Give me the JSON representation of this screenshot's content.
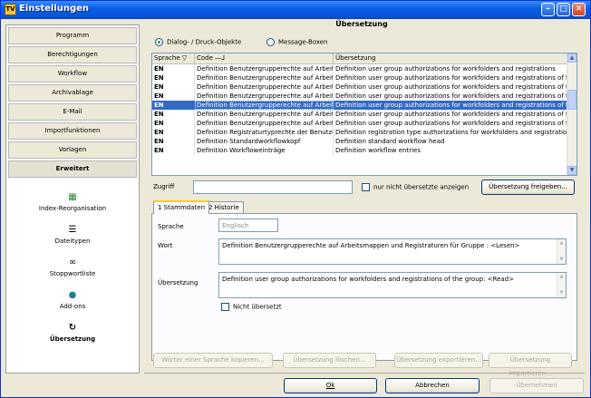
{
  "window": {
    "title": "Einstellungen",
    "app_icon_label": "TV"
  },
  "sidebar": {
    "items": [
      {
        "label": "Programm"
      },
      {
        "label": "Berechtigungen"
      },
      {
        "label": "Workflow"
      },
      {
        "label": "Archivablage"
      },
      {
        "label": "E-Mail"
      },
      {
        "label": "Importfunktionen"
      },
      {
        "label": "Vorlagen"
      },
      {
        "label": "Erweitert"
      }
    ],
    "tools": [
      {
        "label": "Index-Reorganisation",
        "icon": "index-icon"
      },
      {
        "label": "Dateitypen",
        "icon": "list-icon"
      },
      {
        "label": "Stoppwortliste",
        "icon": "chain-icon"
      },
      {
        "label": "Add-ons",
        "icon": "globe-icon"
      },
      {
        "label": "Übersetzung",
        "icon": "translate-icon"
      }
    ]
  },
  "main": {
    "title": "Übersetzung",
    "radio_dialog": "Dialog- / Druck-Objekte",
    "radio_message": "Message-Boxen"
  },
  "grid": {
    "columns": [
      "Sprache",
      "Code",
      "Übersetzung"
    ],
    "rows": [
      {
        "lang": "EN",
        "code": "Definition Benutzergrupperechte auf Arbeitsma",
        "translation": "Definition user group authorizations for workfolders and registrations"
      },
      {
        "lang": "EN",
        "code": "Definition Benutzergrupperechte auf Arbeitsma",
        "translation": "Definition user group authorizations for workfolders and registrations of the group: <"
      },
      {
        "lang": "EN",
        "code": "Definition Benutzergrupperechte auf Arbeitsma",
        "translation": "Definition user group authorizations for workfolders and registrations of the group: <"
      },
      {
        "lang": "EN",
        "code": "Definition Benutzergrupperechte auf Arbeitsma",
        "translation": "Definition user group authorizations for workfolders and registrations of the group: <"
      },
      {
        "lang": "EN",
        "code": "Definition Benutzergrupperechte auf Arbeitsma",
        "translation": "Definition user group authorizations for workfolders and registrations of the group: <"
      },
      {
        "lang": "EN",
        "code": "Definition Benutzergrupperechte auf Arbeitsma",
        "translation": "Definition user group authorizations for workfolders and registrations of the group: <"
      },
      {
        "lang": "EN",
        "code": "Definition Benutzergrupperechte auf Arbeitsma",
        "translation": "Definition user group authorizations for workfolders and registrations of the group: <"
      },
      {
        "lang": "EN",
        "code": "Definition Registraturtyprechte der Benutzergr",
        "translation": "Definition registration type authorizations for workfolders and registrations of the group"
      },
      {
        "lang": "EN",
        "code": "Definition Standardworkflowkopf",
        "translation": "Definition standard workflow head"
      },
      {
        "lang": "EN",
        "code": "Definition Workfloweinträge",
        "translation": "Definition workflow entries"
      }
    ],
    "selected_index": 4
  },
  "filter": {
    "label": "Zugriff",
    "value": "",
    "checkbox_label": "nur nicht übersetzte anzeigen",
    "release_button": "Übersetzung freigeben..."
  },
  "tabs": [
    {
      "label": "1 Stammdaten"
    },
    {
      "label": "2 Historie"
    }
  ],
  "form": {
    "sprache_label": "Sprache",
    "sprache_value": "Englisch",
    "wort_label": "Wort",
    "wort_value": "Definition Benutzergrupperechte auf Arbeitsmappen und Registraturen für Gruppe : <Lesen>",
    "uebersetzung_label": "Übersetzung",
    "uebersetzung_value": "Definition user group authorizations for workfolders and registrations of the group: <Read>",
    "nicht_uebersetzt_label": "Nicht übersetzt"
  },
  "actions": {
    "copy": "Wörter einer Sprache kopieren...",
    "delete": "Übersetzung löschen...",
    "export": "Übersetzung exportieren...",
    "import": "Übersetzung importieren..."
  },
  "footer": {
    "ok": "Ok",
    "cancel": "Abbrechen",
    "apply": "Übernehmen"
  }
}
